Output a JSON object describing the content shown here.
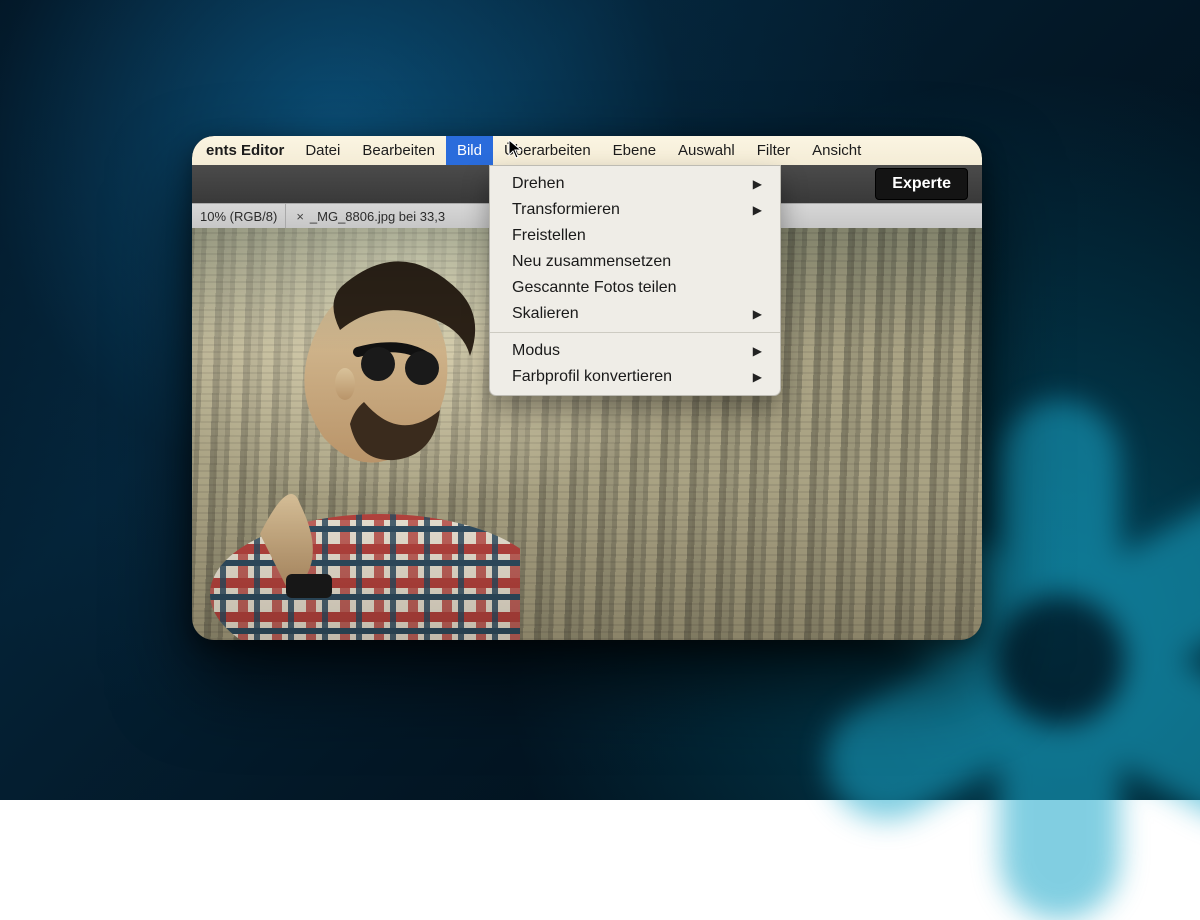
{
  "menubar": {
    "app_label": "ents Editor",
    "items": [
      {
        "label": "Datei"
      },
      {
        "label": "Bearbeiten"
      },
      {
        "label": "Bild",
        "active": true
      },
      {
        "label": "Überarbeiten"
      },
      {
        "label": "Ebene"
      },
      {
        "label": "Auswahl"
      },
      {
        "label": "Filter"
      },
      {
        "label": "Ansicht"
      }
    ]
  },
  "mode_tabs": {
    "experte_label": "Experte"
  },
  "doc_tabs": {
    "tab1_text": "10% (RGB/8)",
    "tab2_close": "×",
    "tab2_text": "_MG_8806.jpg bei 33,3"
  },
  "dropdown": {
    "groups": [
      [
        {
          "label": "Drehen",
          "submenu": true
        },
        {
          "label": "Transformieren",
          "submenu": true
        },
        {
          "label": "Freistellen",
          "submenu": false
        },
        {
          "label": "Neu zusammensetzen",
          "submenu": false
        },
        {
          "label": "Gescannte Fotos teilen",
          "submenu": false
        },
        {
          "label": "Skalieren",
          "submenu": true
        }
      ],
      [
        {
          "label": "Modus",
          "submenu": true
        },
        {
          "label": "Farbprofil konvertieren",
          "submenu": true
        }
      ]
    ]
  },
  "colors": {
    "menu_highlight": "#2a6cdc"
  }
}
